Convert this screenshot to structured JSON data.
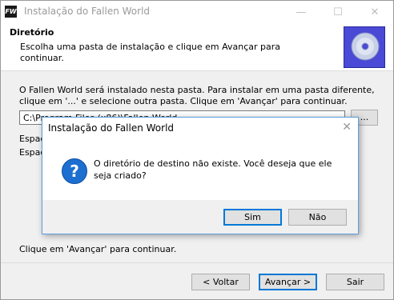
{
  "window": {
    "title": "Instalação do Fallen World",
    "icon_text": "FW",
    "controls": {
      "minimize": "—",
      "maximize": "☐",
      "close": "✕"
    }
  },
  "header": {
    "title": "Diretório",
    "subtitle": "Escolha uma pasta de instalação e clique em Avançar para continuar."
  },
  "body": {
    "instructions": "O Fallen World será instalado nesta pasta. Para instalar em uma pasta diferente, clique em '...' e selecione outra pasta. Clique em 'Avançar' para continuar.",
    "path_value": "C:\\Program Files (x86)\\Fallen World",
    "browse_label": "...",
    "space_required": "Espaç",
    "space_available": "Espaç",
    "footer_text": "Clique em 'Avançar' para continuar."
  },
  "nav": {
    "back": "< Voltar",
    "next": "Avançar >",
    "exit": "Sair"
  },
  "dialog": {
    "title": "Instalação do Fallen World",
    "close": "✕",
    "icon": "?",
    "message": "O diretório de destino não existe. Você deseja que ele seja criado?",
    "yes": "Sim",
    "no": "Não"
  }
}
